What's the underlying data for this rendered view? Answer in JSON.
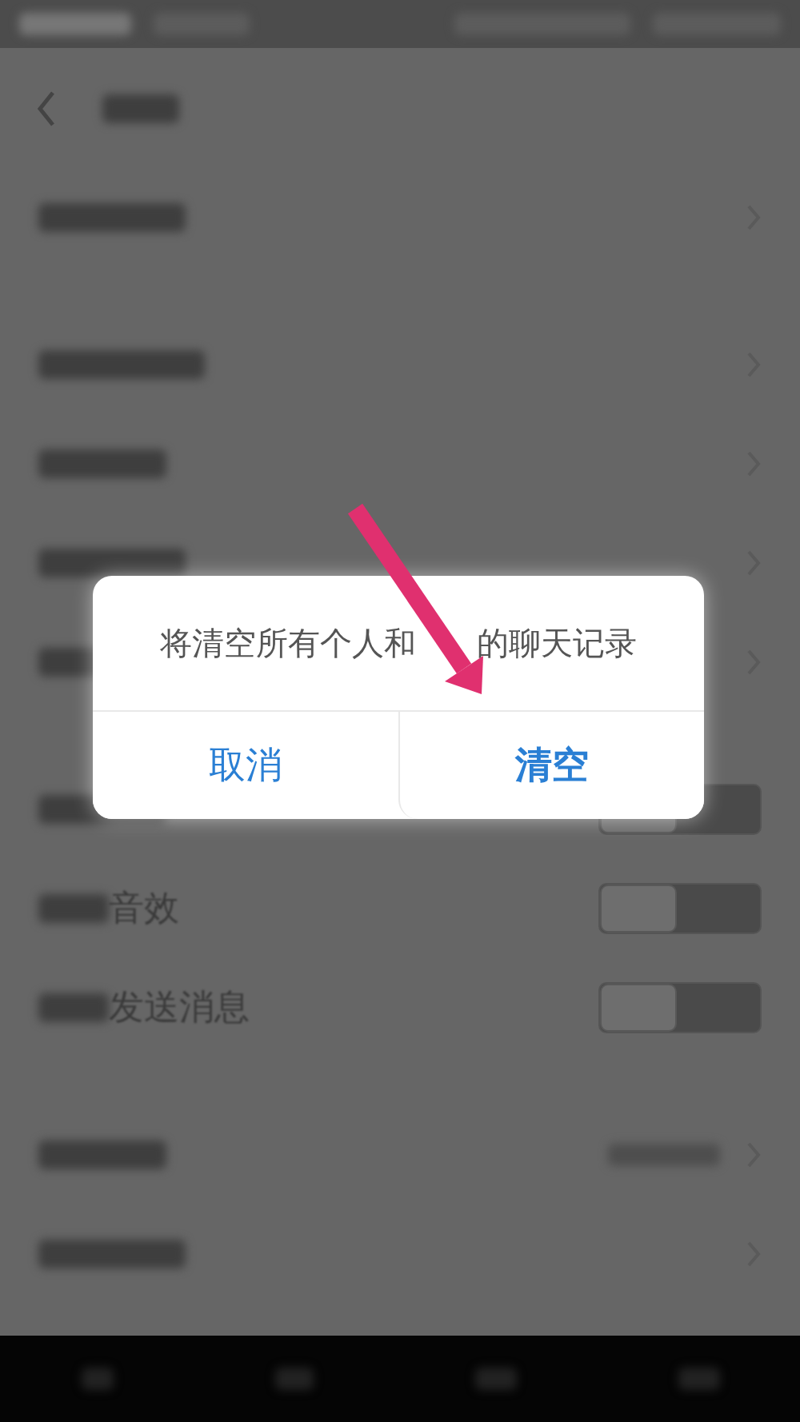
{
  "sections": [
    {
      "rows": [
        {
          "kind": "link"
        }
      ]
    },
    {
      "rows": [
        {
          "kind": "link"
        },
        {
          "kind": "link"
        },
        {
          "kind": "link"
        },
        {
          "kind": "link"
        }
      ]
    },
    {
      "rows": [
        {
          "kind": "toggle",
          "on": false
        },
        {
          "kind": "toggle",
          "on": false,
          "label": "音效"
        },
        {
          "kind": "toggle",
          "on": false,
          "label": "发送消息"
        }
      ]
    },
    {
      "rows": [
        {
          "kind": "value_link"
        },
        {
          "kind": "link"
        }
      ]
    }
  ],
  "dialog": {
    "message_parts": [
      "将清空所有个人和",
      "的聊天记录"
    ],
    "buttons": [
      {
        "label": "取消",
        "bold": false
      },
      {
        "label": "清空",
        "bold": true
      }
    ]
  }
}
